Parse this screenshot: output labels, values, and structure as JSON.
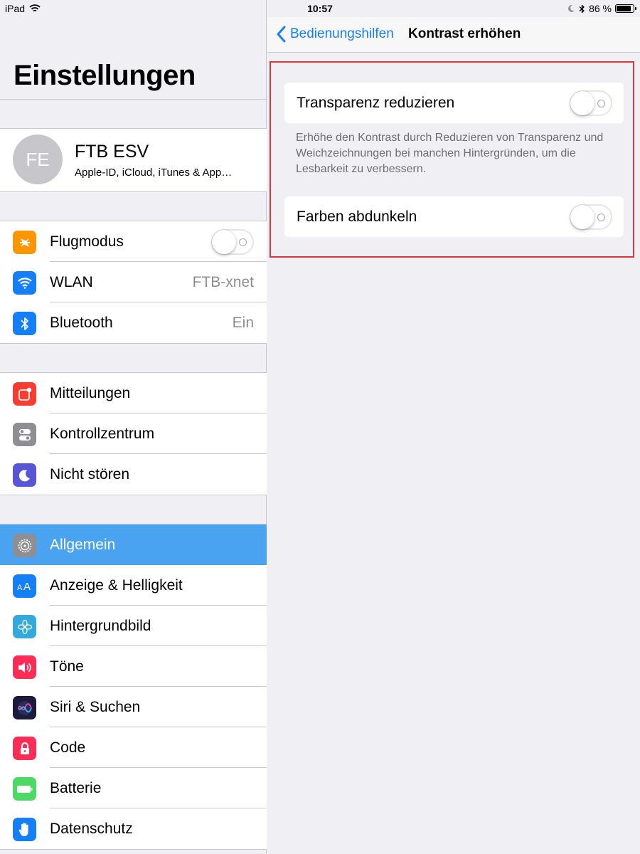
{
  "status": {
    "device": "iPad",
    "time": "10:57",
    "battery_pct": "86 %",
    "battery_fill": 0.86
  },
  "left": {
    "title": "Einstellungen",
    "profile": {
      "initials": "FE",
      "name": "FTB ESV",
      "subtitle": "Apple-ID, iCloud, iTunes & App…"
    },
    "group1": [
      {
        "label": "Flugmodus",
        "value": "",
        "icon": "airplane-icon",
        "color": "#ff9500"
      },
      {
        "label": "WLAN",
        "value": "FTB-xnet",
        "icon": "wifi-icon",
        "color": "#157efb"
      },
      {
        "label": "Bluetooth",
        "value": "Ein",
        "icon": "bluetooth-icon",
        "color": "#157efb"
      }
    ],
    "group2": [
      {
        "label": "Mitteilungen",
        "icon": "notifications-icon",
        "color": "#ff3b30"
      },
      {
        "label": "Kontrollzentrum",
        "icon": "control-center-icon",
        "color": "#8e8e93"
      },
      {
        "label": "Nicht stören",
        "icon": "moon-icon",
        "color": "#5856d6"
      }
    ],
    "group3": [
      {
        "label": "Allgemein",
        "icon": "gear-icon",
        "color": "#8e8e93",
        "selected": true
      },
      {
        "label": "Anzeige & Helligkeit",
        "icon": "display-icon",
        "color": "#157efb"
      },
      {
        "label": "Hintergrundbild",
        "icon": "wallpaper-icon",
        "color": "#34aadc"
      },
      {
        "label": "Töne",
        "icon": "sounds-icon",
        "color": "#ff2d55"
      },
      {
        "label": "Siri & Suchen",
        "icon": "siri-icon",
        "color": "#1c1c3a"
      },
      {
        "label": "Code",
        "icon": "lock-icon",
        "color": "#ff2d55"
      },
      {
        "label": "Batterie",
        "icon": "battery-icon",
        "color": "#4cd964"
      },
      {
        "label": "Datenschutz",
        "icon": "hand-icon",
        "color": "#157efb"
      }
    ]
  },
  "right": {
    "back_label": "Bedienungshilfen",
    "title": "Kontrast erhöhen",
    "option1": "Transparenz reduzieren",
    "footer": "Erhöhe den Kontrast durch Reduzieren von Transparenz und Weichzeichnungen bei manchen Hintergründen, um die Lesbarkeit zu verbessern.",
    "option2": "Farben abdunkeln"
  },
  "colors": {
    "accent": "#157efb",
    "selected_row": "#4aa3f0",
    "highlight_border": "#e0343c"
  }
}
